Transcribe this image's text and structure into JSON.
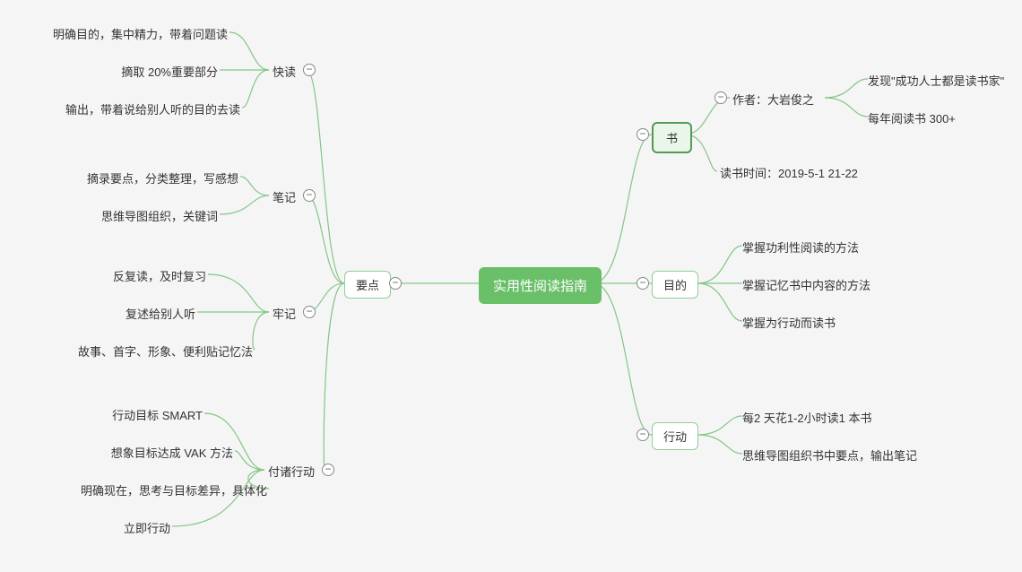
{
  "root": {
    "title": "实用性阅读指南"
  },
  "left": {
    "label": "要点",
    "children": [
      {
        "label": "快读",
        "children": [
          {
            "text": "明确目的，集中精力，带着问题读"
          },
          {
            "text": "摘取 20%重要部分"
          },
          {
            "text": "输出，带着说给别人听的目的去读"
          }
        ]
      },
      {
        "label": "笔记",
        "children": [
          {
            "text": "摘录要点，分类整理，写感想"
          },
          {
            "text": "思维导图组织，关键词"
          }
        ]
      },
      {
        "label": "牢记",
        "children": [
          {
            "text": "反复读，及时复习"
          },
          {
            "text": "复述给别人听"
          },
          {
            "text": "故事、首字、形象、便利贴记忆法"
          }
        ]
      },
      {
        "label": "付诸行动",
        "children": [
          {
            "text": "行动目标 SMART"
          },
          {
            "text": "想象目标达成 VAK 方法"
          },
          {
            "text": "明确现在，思考与目标差异，具体化"
          },
          {
            "text": "立即行动"
          }
        ]
      }
    ]
  },
  "right": {
    "book": {
      "label": "书",
      "author": {
        "label": "作者：大岩俊之",
        "children": [
          {
            "text": "发现\"成功人士都是读书家\""
          },
          {
            "text": "每年阅读书 300+"
          }
        ]
      },
      "time": {
        "text": "读书时间：2019-5-1 21-22"
      }
    },
    "purpose": {
      "label": "目的",
      "children": [
        {
          "text": "掌握功利性阅读的方法"
        },
        {
          "text": "掌握记忆书中内容的方法"
        },
        {
          "text": "掌握为行动而读书"
        }
      ]
    },
    "action": {
      "label": "行动",
      "children": [
        {
          "text": "每2 天花1-2小时读1 本书"
        },
        {
          "text": "思维导图组织书中要点，输出笔记"
        }
      ]
    }
  },
  "glyph": {
    "collapse": "−"
  }
}
